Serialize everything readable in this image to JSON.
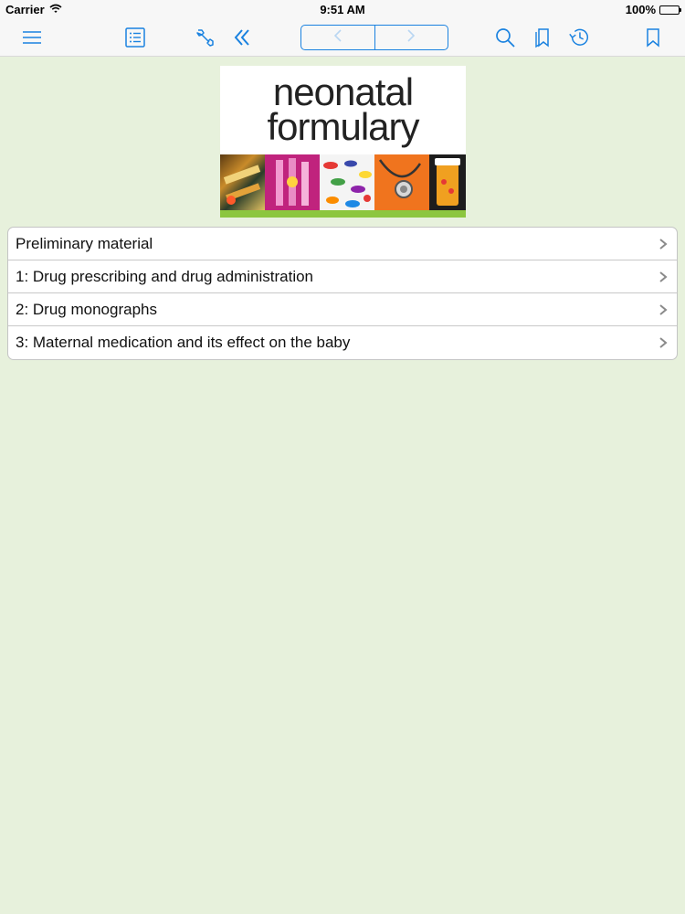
{
  "status_bar": {
    "carrier": "Carrier",
    "time": "9:51 AM",
    "battery": "100%"
  },
  "toolbar": {
    "accent_color": "#1a82e0",
    "icons": [
      "menu-icon",
      "toc-list-icon",
      "wrench-icon",
      "double-chevron-left-icon",
      "back-arrow-icon",
      "forward-arrow-icon",
      "search-icon",
      "bookmarks-icon",
      "history-icon",
      "bookmark-icon"
    ]
  },
  "cover": {
    "title_line1": "neonatal",
    "title_line2": "formulary",
    "band_color": "#8cc63f"
  },
  "chapters": [
    {
      "label": "Preliminary material"
    },
    {
      "label": "1: Drug prescribing and drug administration"
    },
    {
      "label": "2: Drug monographs"
    },
    {
      "label": "3: Maternal medication and its effect on the baby"
    }
  ],
  "background_color": "#e7f1dc"
}
